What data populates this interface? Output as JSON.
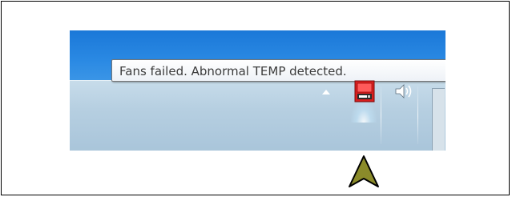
{
  "notification": {
    "tooltip_text": "Fans failed. Abnormal TEMP detected."
  },
  "tray": {
    "overflow_icon": "chevron-up-icon",
    "app_icon": "hardware-monitor-alert-icon",
    "volume_icon": "speaker-icon"
  },
  "pointer": {
    "icon": "arrow-pointer-icon",
    "color": "#8b8b2a"
  },
  "colors": {
    "desktop_blue": "#2a89e3",
    "taskbar": "#b6cfe1",
    "alert_red": "#d81e1e"
  }
}
